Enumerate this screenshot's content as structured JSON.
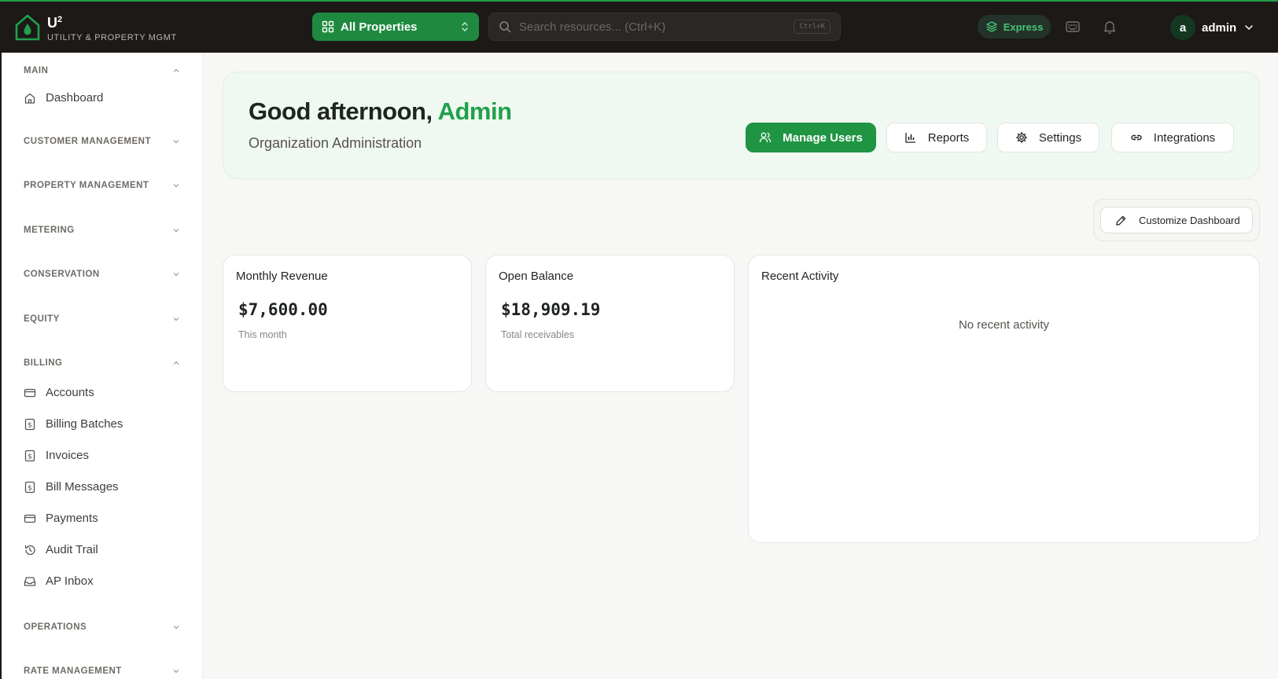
{
  "brand": {
    "name": "U",
    "sup": "2",
    "subtitle": "Utility & Property Mgmt"
  },
  "topbar": {
    "property_selector": "All Properties",
    "search_placeholder": "Search resources... (Ctrl+K)",
    "search_shortcut": "Ctrl+K",
    "express_label": "Express",
    "user": {
      "initial": "a",
      "name": "admin"
    }
  },
  "sidebar": {
    "main": {
      "title": "MAIN",
      "items": [
        {
          "label": "Dashboard",
          "icon": "home-icon"
        }
      ]
    },
    "customer_management": "CUSTOMER MANAGEMENT",
    "property_management": "PROPERTY MANAGEMENT",
    "metering": "METERING",
    "conservation": "CONSERVATION",
    "equity": "EQUITY",
    "billing": {
      "title": "BILLING",
      "items": [
        {
          "label": "Accounts",
          "icon": "credit-card-icon"
        },
        {
          "label": "Billing Batches",
          "icon": "dollar-file-icon"
        },
        {
          "label": "Invoices",
          "icon": "dollar-file-icon"
        },
        {
          "label": "Bill Messages",
          "icon": "dollar-file-icon"
        },
        {
          "label": "Payments",
          "icon": "credit-card-icon"
        },
        {
          "label": "Audit Trail",
          "icon": "history-icon"
        },
        {
          "label": "AP Inbox",
          "icon": "inbox-icon"
        }
      ]
    },
    "operations": "OPERATIONS",
    "rate_management": "RATE MANAGEMENT"
  },
  "hero": {
    "greeting": "Good afternoon,",
    "name": "Admin",
    "subtitle": "Organization Administration",
    "actions": {
      "manage_users": "Manage Users",
      "reports": "Reports",
      "settings": "Settings",
      "integrations": "Integrations"
    }
  },
  "customize_label": "Customize Dashboard",
  "cards": {
    "revenue": {
      "title": "Monthly Revenue",
      "value": "$7,600.00",
      "hint": "This month"
    },
    "balance": {
      "title": "Open Balance",
      "value": "$18,909.19",
      "hint": "Total receivables"
    },
    "activity": {
      "title": "Recent Activity",
      "empty": "No recent activity"
    }
  },
  "colors": {
    "accent": "#22a04b",
    "topbar": "#1c1917",
    "hero_bg": "#eff8f1"
  }
}
